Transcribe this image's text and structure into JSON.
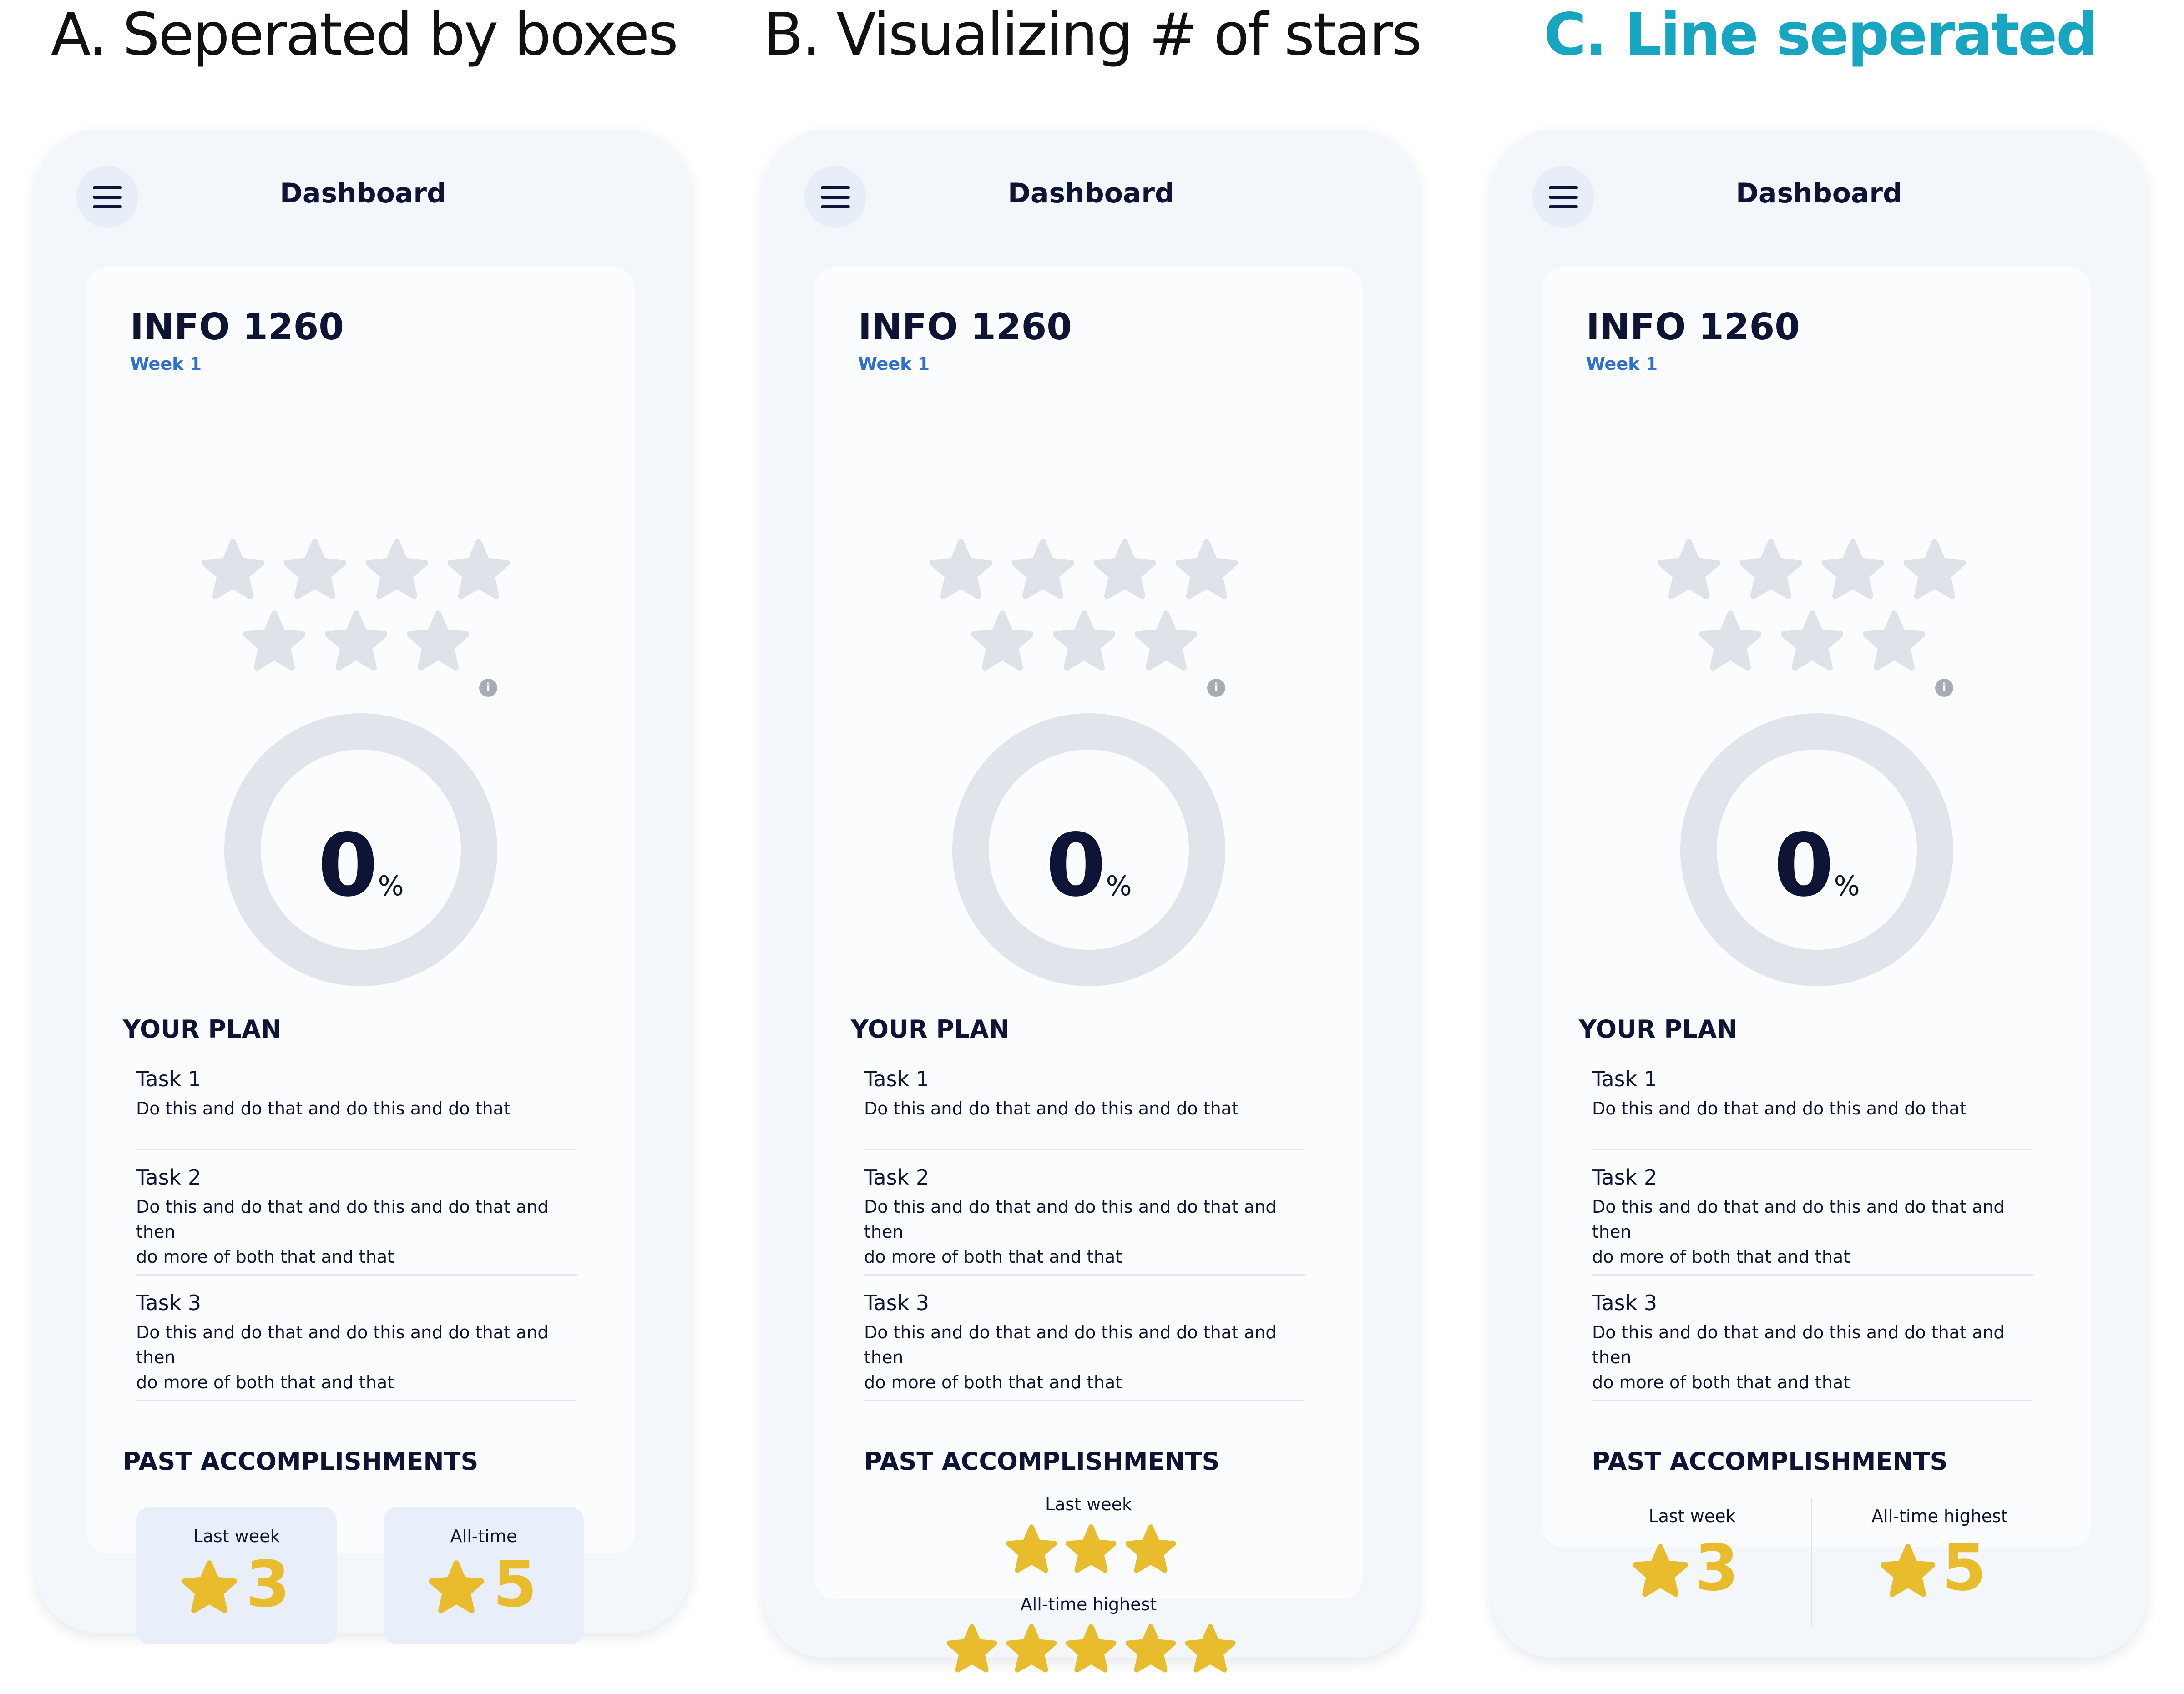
{
  "headings": {
    "a": "A. Seperated by boxes",
    "b": "B. Visualizing # of stars",
    "c": "C. Line seperated"
  },
  "colors": {
    "accent_heading": "#16a6c2",
    "star_gold": "#e8bc2d",
    "star_gray": "#dfe2e8",
    "link_blue": "#2f6fd0",
    "ring_gray": "#e1e4ea",
    "phone_bg": "#f3f6fb"
  },
  "screen": {
    "title": "Dashboard",
    "menu_icon": "hamburger-menu-icon",
    "course": "INFO 1260",
    "week": "Week 1",
    "rating_stars_total": 7,
    "rating_stars_filled": 0,
    "info_icon": "i",
    "progress_value": "0",
    "progress_unit": "%",
    "plan_title": "YOUR PLAN",
    "tasks": [
      {
        "name": "Task 1",
        "desc_line1": "Do this and do that and do this and do that",
        "desc_line2": ""
      },
      {
        "name": "Task 2",
        "desc_line1": "Do this and do that and do this and do that and then",
        "desc_line2": "do more of both that and that"
      },
      {
        "name": "Task 3",
        "desc_line1": "Do this and do that and do this and do that and then",
        "desc_line2": "do more of both that and that"
      }
    ],
    "accomplishments_title": "PAST ACCOMPLISHMENTS"
  },
  "variant_a": {
    "last_week_label": "Last week",
    "last_week_value": "3",
    "alltime_label": "All-time",
    "alltime_value": "5"
  },
  "variant_b": {
    "last_week_label": "Last week",
    "last_week_stars": 3,
    "alltime_label": "All-time highest",
    "alltime_stars": 5
  },
  "variant_c": {
    "last_week_label": "Last week",
    "last_week_value": "3",
    "alltime_label": "All-time highest",
    "alltime_value": "5"
  }
}
